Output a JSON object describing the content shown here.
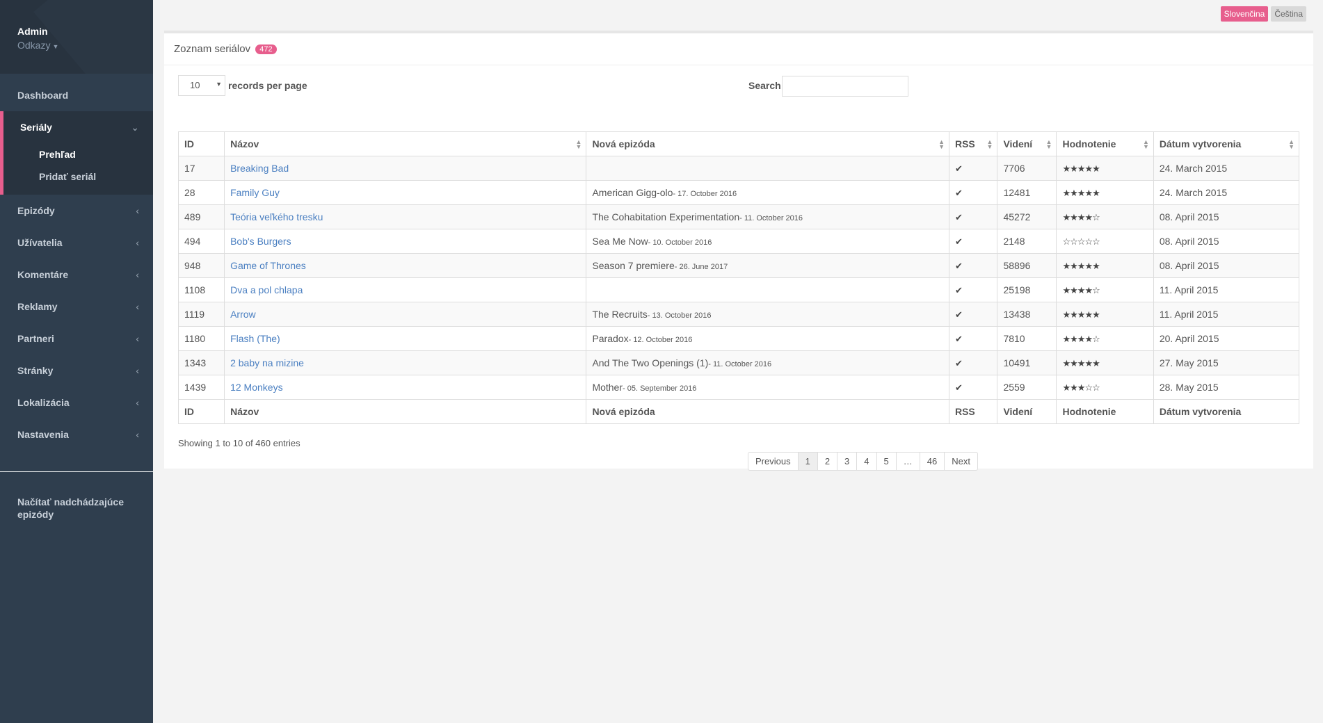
{
  "sidebar": {
    "user": {
      "name": "Admin",
      "links_label": "Odkazy"
    },
    "items": [
      {
        "label": "Dashboard"
      },
      {
        "label": "Seriály"
      },
      {
        "label": "Epizódy"
      },
      {
        "label": "Užívatelia"
      },
      {
        "label": "Komentáre"
      },
      {
        "label": "Reklamy"
      },
      {
        "label": "Partneri"
      },
      {
        "label": "Stránky"
      },
      {
        "label": "Lokalizácia"
      },
      {
        "label": "Nastavenia"
      }
    ],
    "sub_items": [
      {
        "label": "Prehľad"
      },
      {
        "label": "Pridať seriál"
      }
    ],
    "footer_link": "Načítať nadchádzajúce epizódy"
  },
  "lang": {
    "active": "Slovenčina",
    "other": "Čeština"
  },
  "panel": {
    "title": "Zoznam seriálov",
    "count": "472"
  },
  "controls": {
    "length_value": "10",
    "length_label": "records per page",
    "search_label": "Search:"
  },
  "table": {
    "headers": [
      "ID",
      "Názov",
      "Nová epizóda",
      "RSS",
      "Videní",
      "Hodnotenie",
      "Dátum vytvorenia"
    ],
    "rows": [
      {
        "id": "17",
        "name": "Breaking Bad",
        "episode": "",
        "episode_date": "",
        "views": "7706",
        "rating": 5,
        "created": "24. March 2015"
      },
      {
        "id": "28",
        "name": "Family Guy",
        "episode": "American Gigg-olo",
        "episode_date": "- 17. October 2016",
        "views": "12481",
        "rating": 5,
        "created": "24. March 2015"
      },
      {
        "id": "489",
        "name": "Teória veľkého tresku",
        "episode": "The Cohabitation Experimentation",
        "episode_date": "- 11. October 2016",
        "views": "45272",
        "rating": 4,
        "created": "08. April 2015"
      },
      {
        "id": "494",
        "name": "Bob's Burgers",
        "episode": "Sea Me Now",
        "episode_date": "- 10. October 2016",
        "views": "2148",
        "rating": 0,
        "created": "08. April 2015"
      },
      {
        "id": "948",
        "name": "Game of Thrones",
        "episode": "Season 7 premiere",
        "episode_date": "- 26. June 2017",
        "views": "58896",
        "rating": 5,
        "created": "08. April 2015"
      },
      {
        "id": "1108",
        "name": "Dva a pol chlapa",
        "episode": "",
        "episode_date": "",
        "views": "25198",
        "rating": 4,
        "created": "11. April 2015"
      },
      {
        "id": "1119",
        "name": "Arrow",
        "episode": "The Recruits",
        "episode_date": "- 13. October 2016",
        "views": "13438",
        "rating": 5,
        "created": "11. April 2015"
      },
      {
        "id": "1180",
        "name": "Flash (The)",
        "episode": "Paradox",
        "episode_date": "- 12. October 2016",
        "views": "7810",
        "rating": 4,
        "created": "20. April 2015"
      },
      {
        "id": "1343",
        "name": "2 baby na mizine",
        "episode": "And The Two Openings (1)",
        "episode_date": "- 11. October 2016",
        "views": "10491",
        "rating": 5,
        "created": "27. May 2015"
      },
      {
        "id": "1439",
        "name": "12 Monkeys",
        "episode": "Mother",
        "episode_date": "- 05. September 2016",
        "views": "2559",
        "rating": 3,
        "created": "28. May 2015"
      }
    ]
  },
  "info": "Showing 1 to 10 of 460 entries",
  "pagination": [
    "Previous",
    "1",
    "2",
    "3",
    "4",
    "5",
    "…",
    "46",
    "Next"
  ],
  "icons": {
    "rss": "check-icon",
    "rating": "star-icon"
  }
}
